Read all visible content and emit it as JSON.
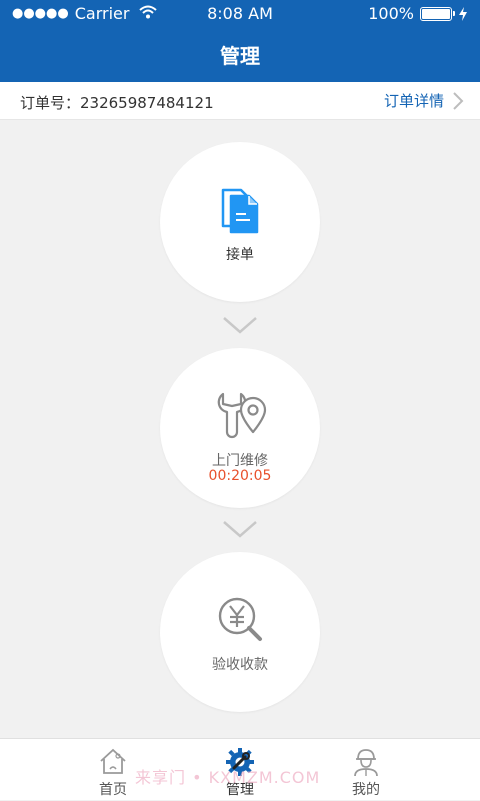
{
  "status_bar": {
    "signal": "●●●●●",
    "carrier": "Carrier",
    "time": "8:08 AM",
    "battery": "100%"
  },
  "header": {
    "title": "管理"
  },
  "order": {
    "label": "订单号：23265987484121",
    "link": "订单详情"
  },
  "steps": [
    {
      "label": "接单",
      "icon": "document-icon",
      "color": "#2196f3"
    },
    {
      "label": "上门维修",
      "time": "00:20:05",
      "icon": "wrench-location-icon"
    },
    {
      "label": "验收收款",
      "icon": "yuan-search-icon"
    }
  ],
  "tabs": [
    {
      "label": "首页",
      "icon": "home-icon"
    },
    {
      "label": "管理",
      "icon": "gear-wrench-icon",
      "active": true
    },
    {
      "label": "我的",
      "icon": "worker-icon"
    }
  ],
  "watermark": "来享门 • KXMZM.COM",
  "colors": {
    "accent": "#1464b4",
    "timer": "#e8502c",
    "doc_icon": "#2196f3"
  }
}
